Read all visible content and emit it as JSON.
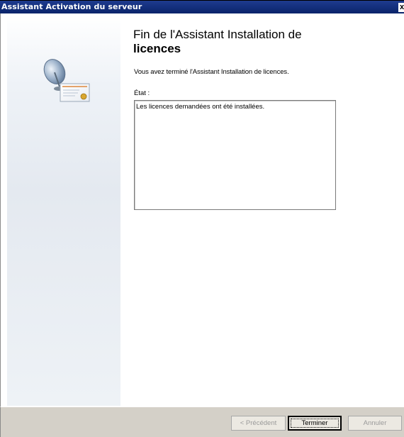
{
  "window": {
    "title": "Assistant Activation du serveur",
    "close_label": "x"
  },
  "main": {
    "heading_line1": "Fin de l'Assistant Installation de",
    "heading_line2": "licences",
    "subtitle": "Vous avez terminé l'Assistant Installation de licences.",
    "state_label": "État :",
    "state_text": "Les licences demandées ont été installées."
  },
  "footer": {
    "prev_label": "< Précédent",
    "finish_label": "Terminer",
    "cancel_label": "Annuler"
  },
  "icons": {
    "wizard": "license-server-certificate-icon"
  }
}
